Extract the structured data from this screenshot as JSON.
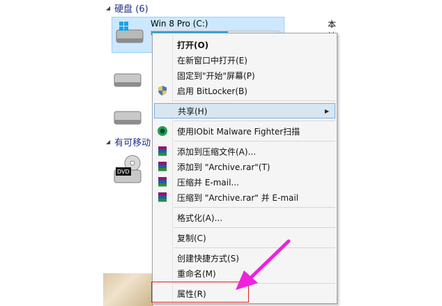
{
  "explorer": {
    "group_hard_disks": "硬盘 (6)",
    "group_removable": "有可移动",
    "drive_c": {
      "name": "Win 8 Pro (C:)",
      "usage_fraction": 0.6
    },
    "drive_right_partial": "本地",
    "dvd_label": "DVD"
  },
  "context_menu": {
    "items": [
      {
        "label": "打开(O)"
      },
      {
        "label": "在新窗口中打开(E)"
      },
      {
        "label": "固定到\"开始\"屏幕(P)"
      },
      {
        "label": "启用 BitLocker(B)"
      },
      {
        "label": "共享(H)"
      },
      {
        "label": "使用IObit Malware Fighter扫描"
      },
      {
        "label": "添加到压缩文件(A)..."
      },
      {
        "label": "添加到 \"Archive.rar\"(T)"
      },
      {
        "label": "压缩并 E-mail..."
      },
      {
        "label": "压缩到 \"Archive.rar\" 并 E-mail"
      },
      {
        "label": "格式化(A)..."
      },
      {
        "label": "复制(C)"
      },
      {
        "label": "创建快捷方式(S)"
      },
      {
        "label": "重命名(M)"
      },
      {
        "label": "属性(R)"
      }
    ]
  },
  "colors": {
    "highlight_box": "#e02020",
    "annotation_arrow": "#ee22dd",
    "selected_tile": "#cce8ff",
    "hover_item": "#d8e6f2"
  }
}
